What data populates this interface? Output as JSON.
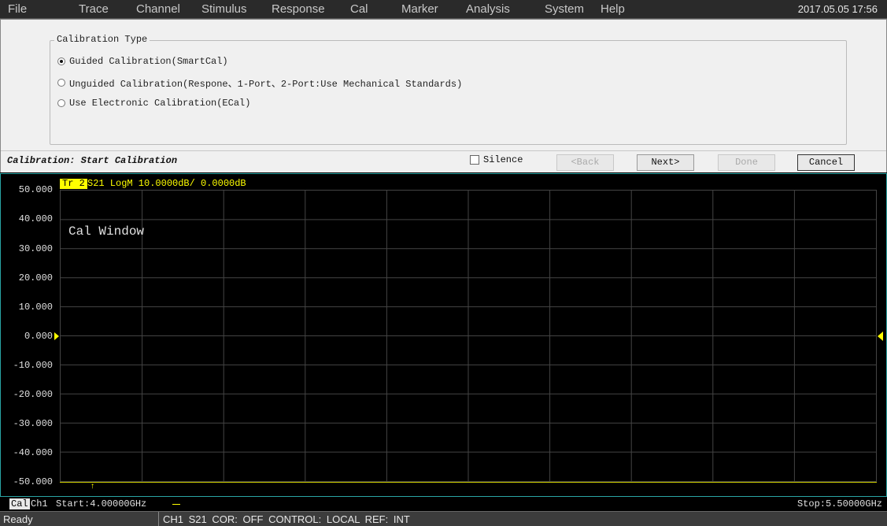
{
  "menu": {
    "items": [
      "File",
      "Trace",
      "Channel",
      "Stimulus",
      "Response",
      "Cal",
      "Marker",
      "Analysis",
      "System",
      "Help"
    ],
    "datetime": "2017.05.05 17:56"
  },
  "dialog": {
    "group_title": "Calibration Type",
    "options": [
      {
        "label": "Guided Calibration(SmartCal)",
        "selected": true
      },
      {
        "label": "Unguided Calibration(Respone、1-Port、2-Port:Use Mechanical Standards)",
        "selected": false
      },
      {
        "label": "Use Electronic Calibration(ECal)",
        "selected": false
      }
    ],
    "step": "Calibration: Start Calibration",
    "silence_label": "Silence",
    "silence_checked": false,
    "buttons": {
      "back": "<Back",
      "next": "Next>",
      "done": "Done",
      "cancel": "Cancel"
    }
  },
  "trace": {
    "badge": "Tr 2",
    "info": "S21 LogM 10.0000dB/ 0.0000dB",
    "window_label": "Cal Window",
    "y_labels": [
      "50.000",
      "40.000",
      "30.000",
      "20.000",
      "10.000",
      "0.000",
      "-10.000",
      "-20.000",
      "-30.000",
      "-40.000",
      "-50.000"
    ],
    "colors": {
      "trace": "#ffff00",
      "grid": "#444444",
      "border": "#2aa4a4"
    }
  },
  "channel": {
    "cal_badge": "Cal",
    "ch": "Ch1",
    "start": "Start:4.00000GHz",
    "stop": "Stop:5.50000GHz"
  },
  "status": {
    "ready": "Ready",
    "info": "CH1 S21 COR: OFF CONTROL: LOCAL REF: INT"
  }
}
